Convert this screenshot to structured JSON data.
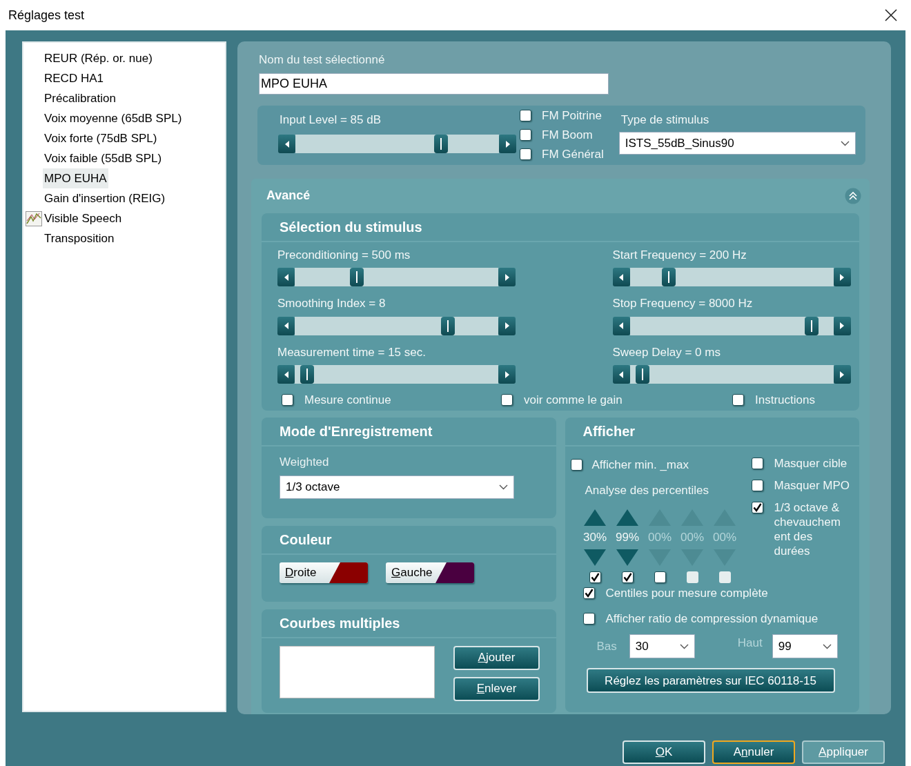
{
  "window": {
    "title": "Réglages test"
  },
  "test_list": [
    {
      "label": "REUR (Rép. or. nue)",
      "selected": false,
      "icon": false
    },
    {
      "label": "RECD HA1",
      "selected": false,
      "icon": false
    },
    {
      "label": "Précalibration",
      "selected": false,
      "icon": false
    },
    {
      "label": "Voix moyenne (65dB SPL)",
      "selected": false,
      "icon": false
    },
    {
      "label": "Voix forte (75dB SPL)",
      "selected": false,
      "icon": false
    },
    {
      "label": "Voix faible (55dB SPL)",
      "selected": false,
      "icon": false
    },
    {
      "label": "MPO EUHA",
      "selected": true,
      "icon": false
    },
    {
      "label": "Gain d'insertion (REIG)",
      "selected": false,
      "icon": false
    },
    {
      "label": "Visible Speech",
      "selected": false,
      "icon": true
    },
    {
      "label": "Transposition",
      "selected": false,
      "icon": false
    }
  ],
  "test_name": {
    "label": "Nom du test sélectionné",
    "value": "MPO EUHA"
  },
  "input_level": {
    "label": "Input Level = 85 dB",
    "level": 0.73
  },
  "fm_options": [
    {
      "label": "FM Poitrine",
      "checked": false
    },
    {
      "label": "FM Boom",
      "checked": false
    },
    {
      "label": "FM Général",
      "checked": false
    }
  ],
  "stimulus_type": {
    "label": "Type de stimulus",
    "value": "ISTS_55dB_Sinus90"
  },
  "advanced": {
    "title": "Avancé",
    "expanded": true
  },
  "stimulus_selection": {
    "title": "Sélection du stimulus",
    "sliders": [
      {
        "label": "Preconditioning = 500 ms",
        "level": 0.29
      },
      {
        "label": "Start Frequency = 200 Hz",
        "level": 0.17
      },
      {
        "label": "Smoothing Index = 8",
        "level": 0.77
      },
      {
        "label": "Stop Frequency = 8000 Hz",
        "level": 0.92
      },
      {
        "label": "Measurement time = 15 sec.",
        "level": 0.03
      },
      {
        "label": "Sweep Delay = 0 ms",
        "level": 0.03
      }
    ],
    "options": [
      {
        "label": "Mesure continue",
        "checked": false
      },
      {
        "label": "voir comme le gain",
        "checked": false
      },
      {
        "label": "Instructions",
        "checked": false
      }
    ]
  },
  "recording_mode": {
    "title": "Mode d'Enregistrement",
    "label": "Weighted",
    "value": "1/3 octave"
  },
  "colour": {
    "title": "Couleur",
    "buttons": [
      {
        "label": "Droite",
        "color": "#8b0000"
      },
      {
        "label": "Gauche",
        "color": "#4a0040"
      }
    ]
  },
  "multiple_curves": {
    "title": "Courbes multiples",
    "buttons": [
      "Ajouter",
      "Enlever"
    ]
  },
  "display": {
    "title": "Afficher",
    "min_max": {
      "label": "Afficher min. _max",
      "checked": false
    },
    "percentile_label": "Analyse des percentiles",
    "percentiles": [
      {
        "value": "30%",
        "active": true,
        "checked": true,
        "checkbox_enabled": true
      },
      {
        "value": "99%",
        "active": true,
        "checked": true,
        "checkbox_enabled": true
      },
      {
        "value": "00%",
        "active": false,
        "checked": false,
        "checkbox_enabled": true
      },
      {
        "value": "00%",
        "active": false,
        "checked": false,
        "checkbox_enabled": false
      },
      {
        "value": "00%",
        "active": false,
        "checked": false,
        "checkbox_enabled": false
      }
    ],
    "right_options": [
      {
        "label": "Masquer cible",
        "checked": false
      },
      {
        "label": "Masquer MPO",
        "checked": false
      },
      {
        "label": "1/3 octave & chevauchem ent des durées",
        "checked": true
      }
    ],
    "bottom_options": [
      {
        "label": "Centiles pour mesure complète",
        "checked": true
      },
      {
        "label": "Afficher ratio de compression dynamique",
        "checked": false
      }
    ],
    "low": {
      "label": "Bas",
      "value": "30"
    },
    "high": {
      "label": "Haut",
      "value": "99"
    },
    "iec_button": "Réglez les paramètres sur IEC 60118-15"
  },
  "footer_buttons": [
    {
      "label": "OK",
      "focused": false,
      "disabled": false
    },
    {
      "label": "Annuler",
      "focused": true,
      "disabled": false
    },
    {
      "label": "Appliquer",
      "focused": false,
      "disabled": true
    }
  ]
}
